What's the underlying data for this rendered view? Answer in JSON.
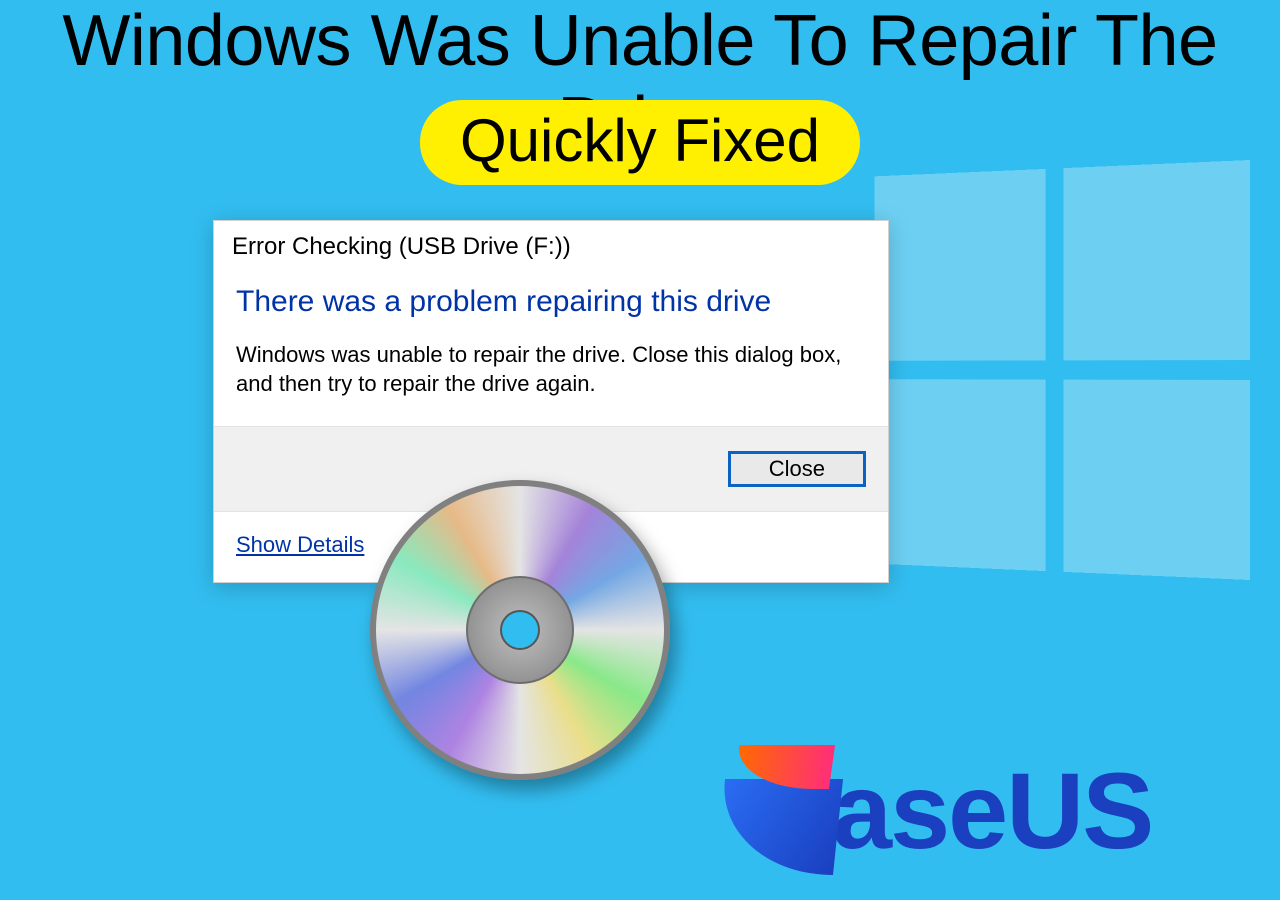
{
  "headline": "Windows Was Unable To Repair The Drive",
  "pill": "Quickly Fixed",
  "dialog": {
    "title": "Error Checking (USB Drive (F:))",
    "message_title": "There was a problem repairing this drive",
    "message_body": "Windows was unable to repair the drive. Close this dialog box, and then try to repair the drive again.",
    "close_label": "Close",
    "show_details_label": "Show Details"
  },
  "brand": {
    "text": "aseUS"
  }
}
